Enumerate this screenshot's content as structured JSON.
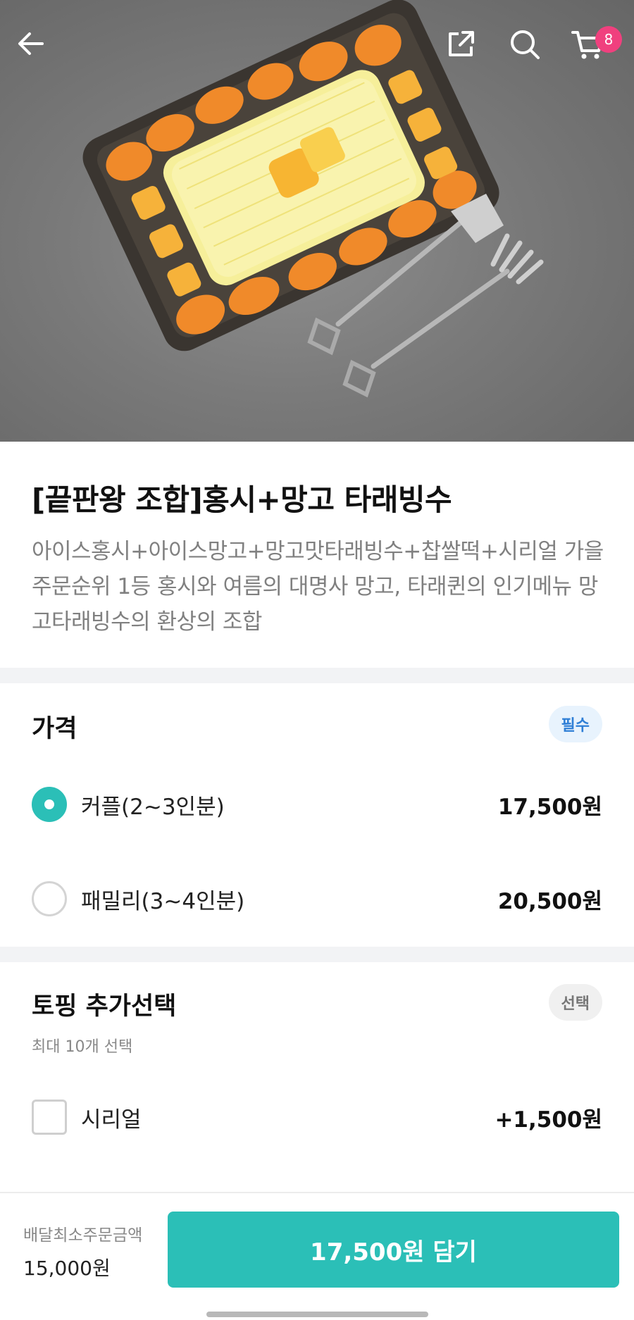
{
  "header": {
    "back_icon": "arrow-left-icon",
    "share_icon": "share-external-icon",
    "search_icon": "search-icon",
    "cart_icon": "cart-icon",
    "cart_count": "8"
  },
  "product": {
    "title": "[끝판왕 조합]홍시+망고 타래빙수",
    "description": "아이스홍시+아이스망고+망고맛타래빙수+찹쌀떡+시리얼 가을 주문순위 1등 홍시와 여름의 대명사 망고, 타래퀸의 인기메뉴 망고타래빙수의 환상의 조합"
  },
  "price_section": {
    "title": "가격",
    "tag": "필수",
    "options": [
      {
        "label": "커플(2~3인분)",
        "price": "17,500원",
        "selected": true
      },
      {
        "label": "패밀리(3~4인분)",
        "price": "20,500원",
        "selected": false
      }
    ]
  },
  "topping_section": {
    "title": "토핑 추가선택",
    "tag": "선택",
    "note": "최대 10개 선택",
    "options": [
      {
        "label": "시리얼",
        "price": "+1,500원",
        "checked": false
      }
    ]
  },
  "footer": {
    "min_order_label": "배달최소주문금액",
    "min_order_value": "15,000원",
    "cta_label": "17,500원 담기"
  },
  "colors": {
    "accent": "#2bbfb7",
    "badge": "#f0407e",
    "required_tag": "#2f7fd6"
  }
}
